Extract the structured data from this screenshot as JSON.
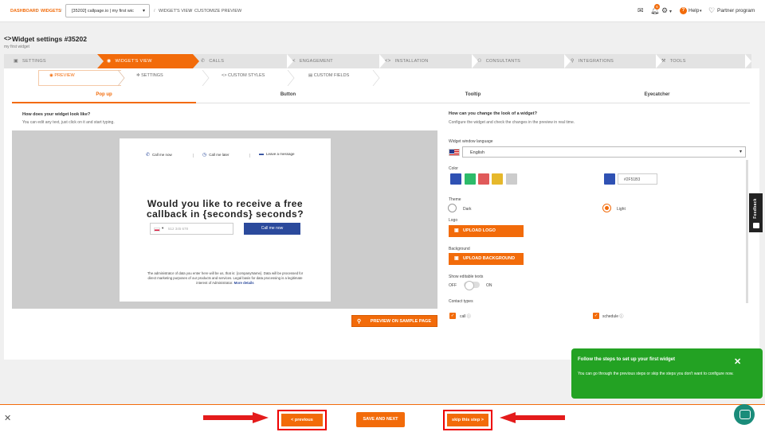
{
  "topbar": {
    "breadcrumb": [
      "DASHBOARD",
      "WIDGETS"
    ],
    "widget_select": "[35202] callpage.io | my first wic",
    "breadcrumb_tail": [
      "WIDGET'S VIEW",
      "CUSTOMIZE PREVIEW"
    ],
    "notification_count": "6",
    "help_label": "Help",
    "partner_label": "Partner program"
  },
  "header": {
    "code_icon": "<>",
    "title": "Widget settings #35202",
    "subtitle": "my first widget"
  },
  "steps": [
    {
      "label": "SETTINGS",
      "icon": "▣"
    },
    {
      "label": "WIDGET'S VIEW",
      "icon": "◉"
    },
    {
      "label": "CALLS",
      "icon": "✆"
    },
    {
      "label": "ENGAGEMENT",
      "icon": "<"
    },
    {
      "label": "INSTALLATION",
      "icon": "<>"
    },
    {
      "label": "CONSULTANTS",
      "icon": "⚇"
    },
    {
      "label": "INTEGRATIONS",
      "icon": "⚲"
    },
    {
      "label": "TOOLS",
      "icon": "⚒"
    }
  ],
  "subtabs": [
    {
      "label": "PREVIEW",
      "icon": "◉"
    },
    {
      "label": "SETTINGS",
      "icon": "✲"
    },
    {
      "label": "CUSTOM STYLES",
      "icon": "<>"
    },
    {
      "label": "CUSTOM FIELDS",
      "icon": "▤"
    }
  ],
  "kind_tabs": [
    "Pop up",
    "Button",
    "Tooltip",
    "Eyecatcher"
  ],
  "left": {
    "question": "How does your widget look like?",
    "hint": "You can edit any text, just click on it and start typing."
  },
  "widget_preview": {
    "tabs": [
      {
        "label": "Call me now",
        "icon": "✆"
      },
      {
        "label": "Call me later",
        "icon": "◷"
      },
      {
        "label": "Leave a message",
        "icon": "▬"
      }
    ],
    "divider": "|",
    "headline_1": "Would you like to receive a free",
    "headline_2": "callback in {seconds} seconds?",
    "phone_placeholder": "512 345 678",
    "call_button": "Call me now",
    "legal_text": "The administrator of data you enter here will be us, that is: {companyName}. Data will be processed for direct marketing purposes of our products and services. Legal basis for data processing is a legitimate interest of Administrator.",
    "legal_link": "More details"
  },
  "sample_button": "PREVIEW ON SAMPLE PAGE",
  "right": {
    "question": "How can you change the look of a widget?",
    "hint": "Configure the widget and check the changes in the preview in real time.",
    "language_label": "Widget window language",
    "language_value": "English",
    "color_label": "Color",
    "swatches": [
      "#2f51b3",
      "#2dbb6a",
      "#e05a5a",
      "#e6b82b",
      "#cccccc"
    ],
    "hex_value": "#2F51B3",
    "hex_swatch": "#2f51b3",
    "theme_label": "Theme",
    "theme_dark": "Dark",
    "theme_light": "Light",
    "logo_label": "Logo",
    "upload_logo": "UPLOAD LOGO",
    "background_label": "Background",
    "upload_background": "UPLOAD BACKGROUND",
    "editable_label": "Show editable texts",
    "toggle_off": "OFF",
    "toggle_on": "ON",
    "contact_label": "Contact types",
    "contact_call": "call",
    "contact_schedule": "schedule"
  },
  "feedback": "Feedback",
  "guide": {
    "title": "Follow the steps to set up your first widget",
    "body": "You can go through the previous steps or skip the steps you don't want to configure now."
  },
  "bottom": {
    "previous": "< previous",
    "save_next": "SAVE AND NEXT",
    "skip": "skip this step >"
  },
  "accent_color": "#f26b0a"
}
